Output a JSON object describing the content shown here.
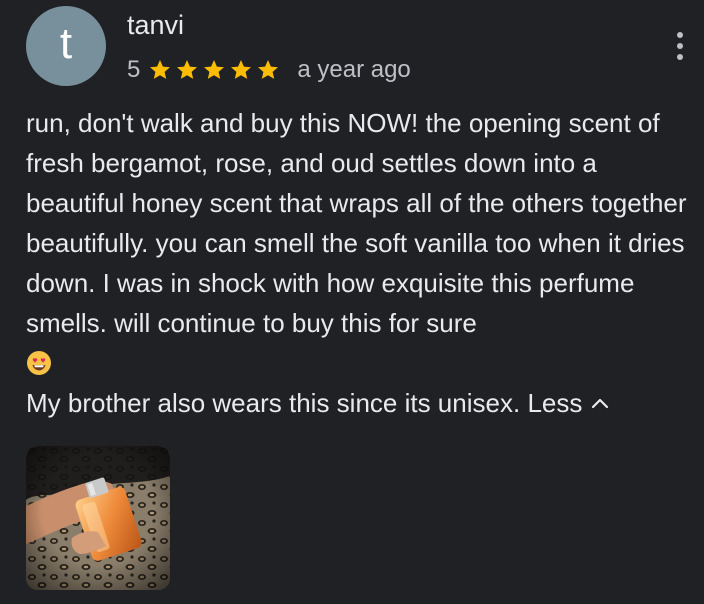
{
  "reviewer": {
    "name": "tanvi",
    "initial": "t",
    "avatar_color": "#78909c"
  },
  "rating": {
    "value": "5",
    "stars_filled": 5,
    "star_color": "#fbbc04"
  },
  "time_ago": "a year ago",
  "review": {
    "paragraph_1": "run, don't walk and buy this NOW! the opening scent of fresh bergamot, rose, and oud settles down into a beautiful honey scent that wraps all of the others together beautifully. you can smell the soft vanilla too when it dries down. I was in shock with how exquisite this perfume smells. will continue to buy this for sure",
    "emoji": "smiling-face-with-heart-eyes",
    "paragraph_2": "My brother also wears this since its unisex.",
    "less_label": "Less"
  },
  "photo": {
    "subject": "hand holding orange perfume bottle on leopard print fabric"
  },
  "icons": {
    "more": "more-vert-icon",
    "chevron": "chevron-up-icon",
    "star": "star-icon"
  }
}
